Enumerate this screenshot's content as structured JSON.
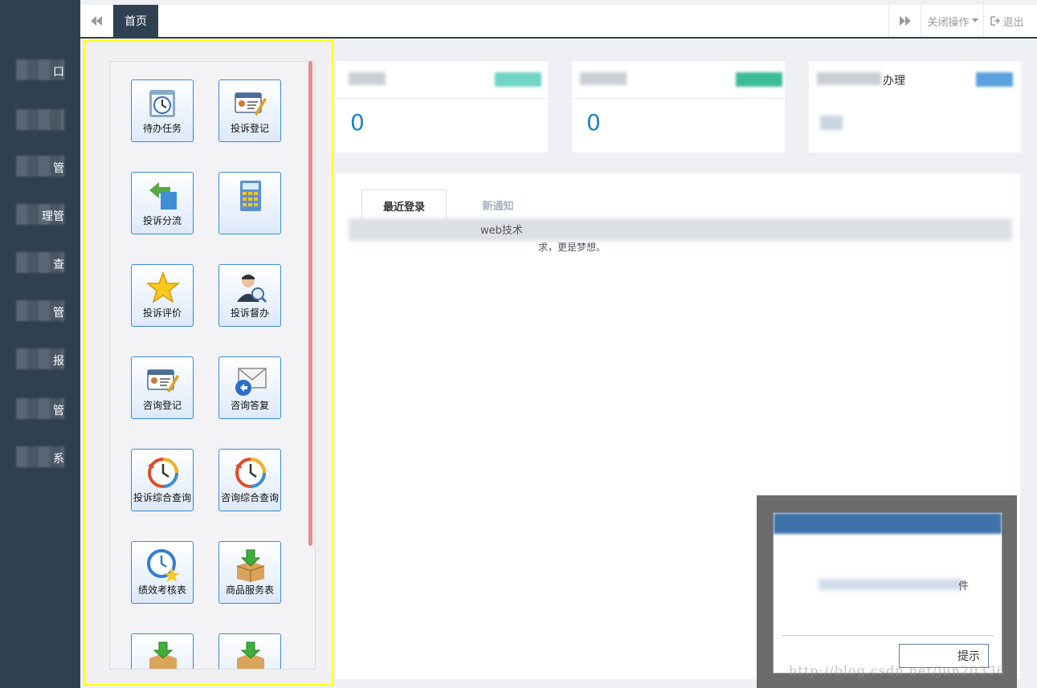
{
  "topbar": {
    "home_tab": "首页",
    "close_ops": "关闭操作",
    "logout": "退出"
  },
  "sidebar": {
    "items": [
      {
        "label": "口"
      },
      {
        "label": ""
      },
      {
        "label": "管"
      },
      {
        "label": "理管"
      },
      {
        "label": "查"
      },
      {
        "label": "管"
      },
      {
        "label": "报"
      },
      {
        "label": "管"
      },
      {
        "label": "系"
      }
    ]
  },
  "shortcuts": [
    {
      "label": "待办任务",
      "icon": "calendar-clock-icon"
    },
    {
      "label": "投诉登记",
      "icon": "id-card-pen-icon"
    },
    {
      "label": "投诉分流",
      "icon": "arrow-folder-icon"
    },
    {
      "label": "",
      "icon": "calculator-icon"
    },
    {
      "label": "投诉评价",
      "icon": "star-icon"
    },
    {
      "label": "投诉督办",
      "icon": "user-search-icon"
    },
    {
      "label": "咨询登记",
      "icon": "id-card-pen-icon"
    },
    {
      "label": "咨询答复",
      "icon": "mail-reply-icon"
    },
    {
      "label": "投诉综合查询",
      "icon": "clock-history-icon"
    },
    {
      "label": "咨询综合查询",
      "icon": "clock-history-icon"
    },
    {
      "label": "绩效考核表",
      "icon": "clock-star-icon"
    },
    {
      "label": "商品服务表",
      "icon": "box-download-icon"
    },
    {
      "label": "",
      "icon": "box-download-icon"
    },
    {
      "label": "",
      "icon": "box-download-icon"
    }
  ],
  "stats": [
    {
      "value": "0"
    },
    {
      "value": "0"
    },
    {
      "title": "办理"
    }
  ],
  "main": {
    "tab_recent": "最近登录",
    "tab_notice": "新通知",
    "line1_visible": "web技术",
    "line2_visible": "求，更是梦想。"
  },
  "dialog": {
    "body_visible": "件",
    "button_visible": "提示"
  },
  "watermark": "http://blog.csdn.net/jun20336"
}
